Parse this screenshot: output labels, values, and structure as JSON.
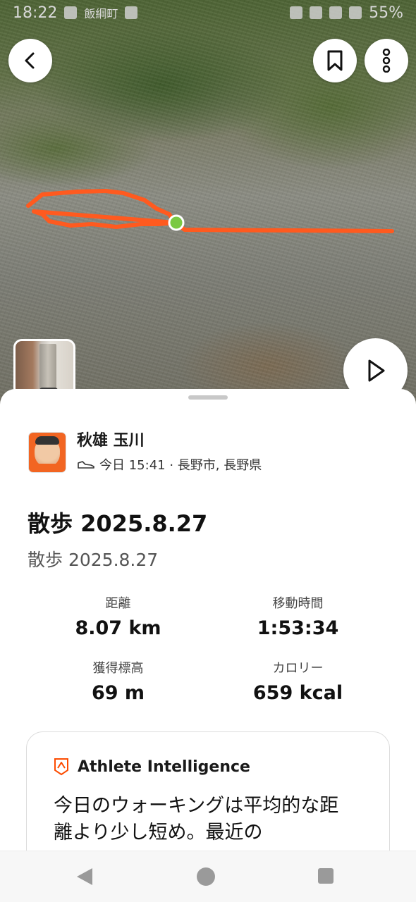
{
  "status_bar": {
    "time": "18:22",
    "notification_text": "飯綱町",
    "battery": "55%"
  },
  "map": {
    "route_color": "#ff5a1f",
    "marker_color": "#7ac943"
  },
  "activity": {
    "author_name": "秋雄 玉川",
    "meta": "今日 15:41 · 長野市, 長野県",
    "title": "散歩 2025.8.27",
    "subtitle": "散歩 2025.8.27"
  },
  "stats": [
    {
      "label": "距離",
      "value": "8.07 km"
    },
    {
      "label": "移動時間",
      "value": "1:53:34"
    },
    {
      "label": "獲得標高",
      "value": "69 m"
    },
    {
      "label": "カロリー",
      "value": "659 kcal"
    }
  ],
  "athlete_intelligence": {
    "title": "Athlete Intelligence",
    "body": "今日のウォーキングは平均的な距離より少し短め。最近の"
  },
  "icons": {
    "back": "chevron-left-icon",
    "bookmark": "bookmark-icon",
    "more": "more-vertical-icon",
    "play": "play-icon",
    "shoe": "shoe-icon",
    "ai": "athlete-intelligence-icon"
  },
  "brand_color": "#fc4c02"
}
